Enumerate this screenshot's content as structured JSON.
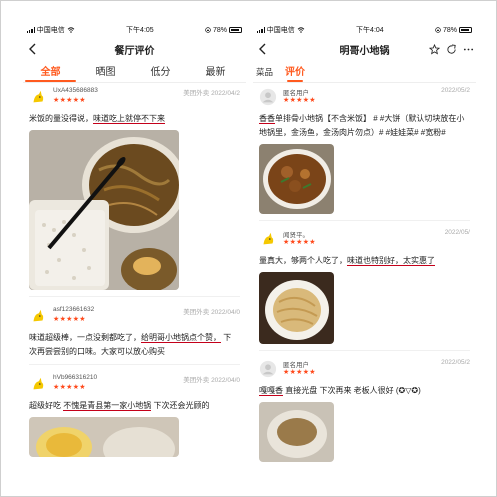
{
  "left": {
    "status": {
      "carrier": "中国电信",
      "time": "下午4:05",
      "battery": "78%"
    },
    "nav": {
      "title": "餐厅评价",
      "back": "<"
    },
    "tabs": [
      "全部",
      "晒图",
      "低分",
      "最新"
    ],
    "reviews": [
      {
        "user": "UxA435686883",
        "meta": "美团外卖 2022/04/2",
        "stars": "★★★★★",
        "text_pre": "米饭的量没得说，",
        "text_ul": "味道吃上就停不下来",
        "text_post": ""
      },
      {
        "user": "asf123661632",
        "meta": "美团外卖 2022/04/0",
        "stars": "★★★★★",
        "line1_pre": "味道超级棒，一点没剩都吃了，",
        "line1_ul": "给明哥小地锅点个赞，",
        "line1_post": " 下",
        "line2": "次再尝尝别的口味。大家可以放心购买"
      },
      {
        "user": "hVb966316210",
        "meta": "美团外卖 2022/04/0",
        "stars": "★★★★★",
        "text_pre": "超级好吃 ",
        "text_ul": "不愧是青县第一家小地锅",
        "text_post": " 下次还会光顾的"
      }
    ]
  },
  "right": {
    "status": {
      "carrier": "中国电信",
      "time": "下午4:04",
      "battery": "78%"
    },
    "nav": {
      "title": "明哥小地锅",
      "back": "<"
    },
    "tabs": [
      "菜品",
      "评价"
    ],
    "reviews": [
      {
        "user": "匿名用户",
        "meta": "2022/05/2",
        "stars": "★★★★★",
        "line1_ul": "香香",
        "line1_post": "单排骨小地锅【不含米饭】 # #大饼（默认切块放在小",
        "line2": "地锅里，金汤鱼，金汤肉片勿点）# #娃娃菜# #宽粉#"
      },
      {
        "user": "闻贤平。",
        "meta": "2022/05/",
        "stars": "★★★★★",
        "text_pre": "量真大，够两个人吃了，",
        "text_ul": "味道也特别好，太实惠了",
        "text_post": ""
      },
      {
        "user": "匿名用户",
        "meta": "2022/05/2",
        "stars": "★★★★★",
        "text_pre": "",
        "text_ul": "嘎嘎香",
        "text_post": " 直接光盘 下次再来 老板人很好 (✪▽✪)"
      }
    ]
  },
  "colors": {
    "accent": "#ff5a1f",
    "star": "#ff4a1c",
    "underline": "#c4001a"
  }
}
